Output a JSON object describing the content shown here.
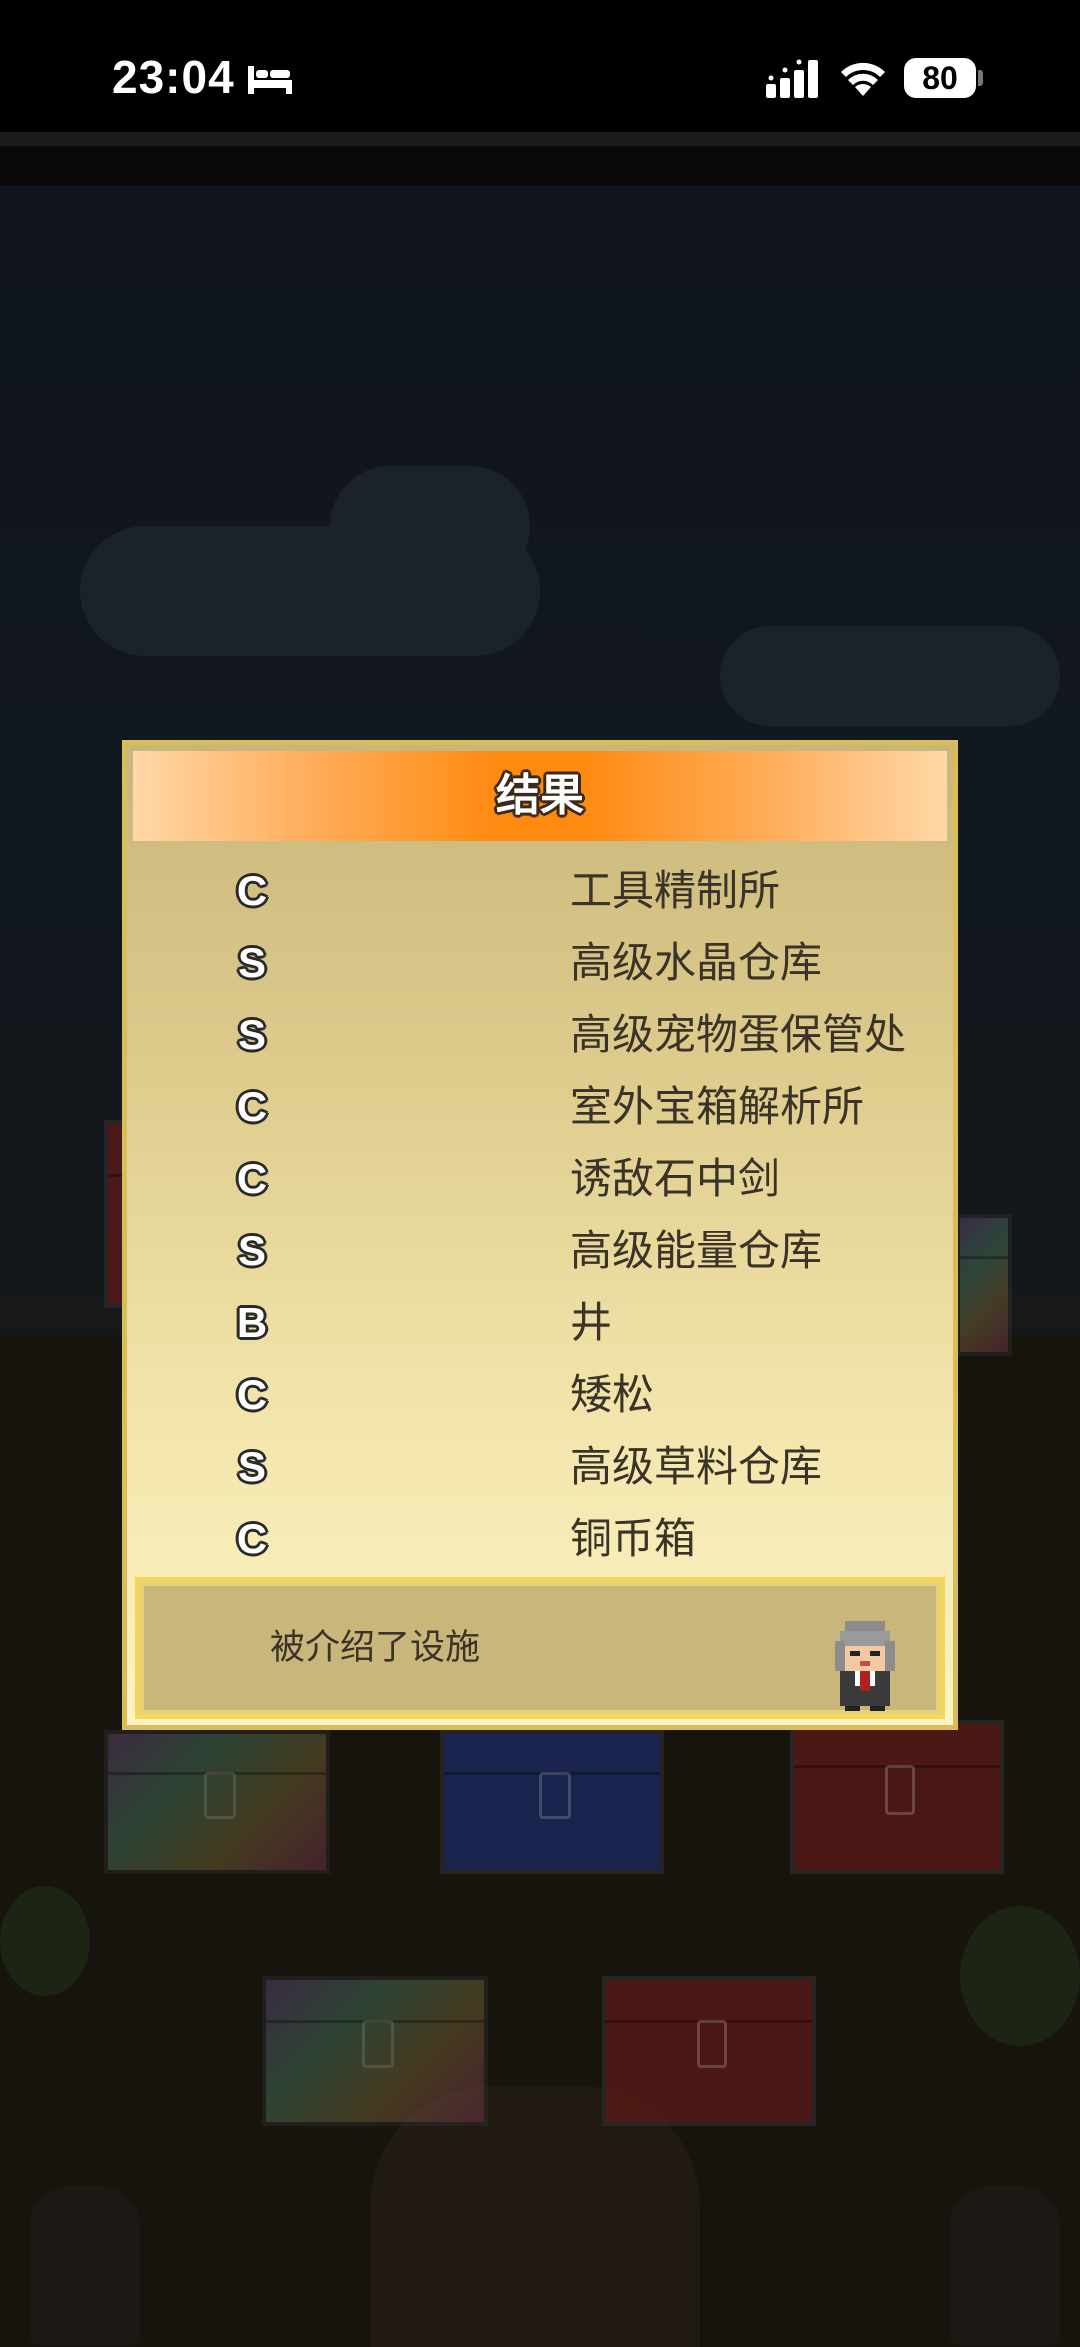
{
  "status_bar": {
    "time": "23:04",
    "battery": "80",
    "icons": [
      "bed-icon",
      "signal-icon",
      "wifi-icon",
      "battery-icon"
    ]
  },
  "dialog": {
    "title": "结果",
    "results": [
      {
        "rank": "C",
        "facility": "工具精制所"
      },
      {
        "rank": "S",
        "facility": "高级水晶仓库"
      },
      {
        "rank": "S",
        "facility": "高级宠物蛋保管处"
      },
      {
        "rank": "C",
        "facility": "室外宝箱解析所"
      },
      {
        "rank": "C",
        "facility": "诱敌石中剑"
      },
      {
        "rank": "S",
        "facility": "高级能量仓库"
      },
      {
        "rank": "B",
        "facility": "井"
      },
      {
        "rank": "C",
        "facility": "矮松"
      },
      {
        "rank": "S",
        "facility": "高级草料仓库"
      },
      {
        "rank": "C",
        "facility": "铜币箱"
      }
    ],
    "footer_message": "被介绍了设施"
  },
  "colors": {
    "header_orange": "#ff8a10",
    "dialog_border": "#d8be5a",
    "footer_border": "#f3d65c",
    "text_dark": "#3a3428"
  }
}
